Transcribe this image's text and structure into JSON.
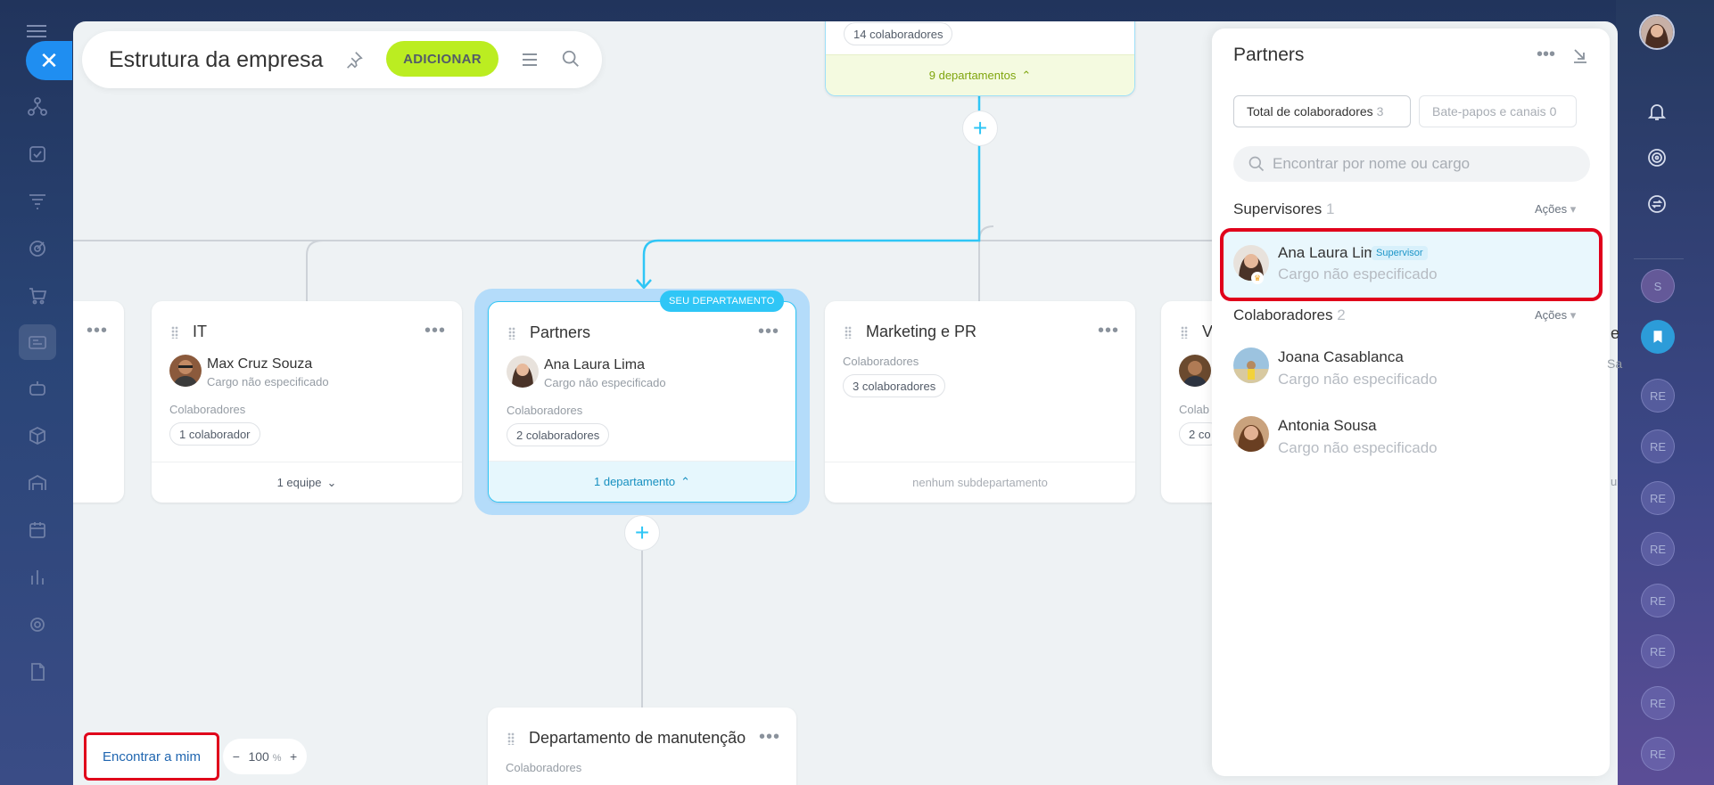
{
  "toolbar": {
    "title": "Estrutura da empresa",
    "add_label": "ADICIONAR"
  },
  "cards": {
    "top": {
      "chip": "14 colaboradores",
      "footer": "9 departamentos"
    },
    "partial_left": {
      "dots": "•••"
    },
    "it": {
      "name": "IT",
      "head_name": "Max Cruz Souza",
      "head_role": "Cargo não especificado",
      "col_label": "Colaboradores",
      "chip": "1 colaborador",
      "footer": "1 equipe"
    },
    "partners": {
      "badge": "SEU DEPARTAMENTO",
      "name": "Partners",
      "head_name": "Ana Laura Lima",
      "head_role": "Cargo não especificado",
      "col_label": "Colaboradores",
      "chip": "2 colaboradores",
      "footer": "1 departamento"
    },
    "marketing": {
      "name": "Marketing e PR",
      "col_label": "Colaboradores",
      "chip": "3 colaboradores",
      "footer": "nenhum subdepartamento"
    },
    "partial_right": {
      "name": "V",
      "col_label": "Colab",
      "chip": "2 co"
    },
    "manutencao": {
      "name": "Departamento de manutenção",
      "col_label": "Colaboradores"
    }
  },
  "bottom": {
    "find_me": "Encontrar a mim",
    "zoom_minus": "−",
    "zoom_value": "100",
    "zoom_unit": "%",
    "zoom_plus": "+"
  },
  "panel": {
    "title": "Partners",
    "tabs": [
      {
        "label": "Total de colaboradores",
        "count": "3"
      },
      {
        "label": "Bate-papos e canais",
        "count": "0"
      }
    ],
    "search_placeholder": "Encontrar por nome ou cargo",
    "supervisors": {
      "label": "Supervisores",
      "count": "1",
      "actions": "Ações",
      "items": [
        {
          "name": "Ana Laura Lima",
          "tag": "Supervisor",
          "role": "Cargo não especificado"
        }
      ]
    },
    "employees": {
      "label": "Colaboradores",
      "count": "2",
      "actions": "Ações",
      "items": [
        {
          "name": "Joana Casablanca",
          "role": "Cargo não especificado"
        },
        {
          "name": "Antonia Sousa",
          "role": "Cargo não especificado"
        }
      ]
    },
    "edge_text": {
      "e": "e",
      "sa": "Sa",
      "u": "u"
    }
  },
  "right_sidebar": {
    "s_label": "S",
    "re_label": "RE"
  },
  "colors": {
    "accent_blue": "#2fc6f6",
    "add_green": "#bbed21",
    "highlight_red": "#e0001b",
    "close_blue": "#1f8ef1"
  }
}
